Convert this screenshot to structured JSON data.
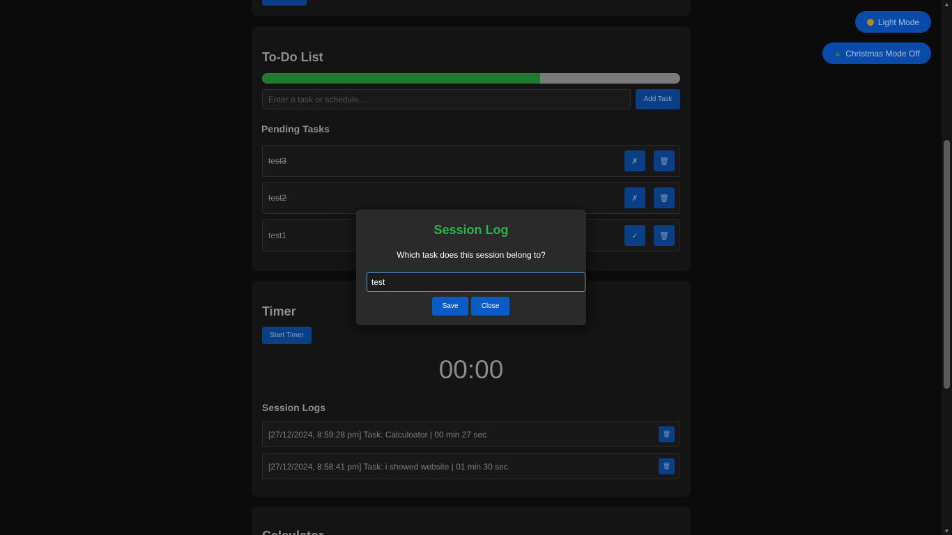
{
  "todo": {
    "title": "To-Do List",
    "progress_fraction": 0.665,
    "input_placeholder": "Enter a task or schedule...",
    "add_label": "Add Task",
    "pending_heading": "Pending Tasks",
    "tasks": [
      {
        "text": "test3",
        "done": true,
        "toggle_glyph": "✗",
        "delete_glyph": "🗑"
      },
      {
        "text": "test2",
        "done": true,
        "toggle_glyph": "✗",
        "delete_glyph": "🗑"
      },
      {
        "text": "test1",
        "done": false,
        "toggle_glyph": "✓",
        "delete_glyph": "🗑"
      }
    ]
  },
  "timer": {
    "title": "Timer",
    "start_label": "Start Timer",
    "display": "00:00",
    "logs_heading": "Session Logs",
    "logs": [
      {
        "text": "[27/12/2024, 8:59:28 pm] Task: Calculoator | 00 min 27 sec",
        "delete_glyph": "🗑"
      },
      {
        "text": "[27/12/2024, 8:58:41 pm] Task: i showed website | 01 min 30 sec",
        "delete_glyph": "🗑"
      }
    ]
  },
  "calculator": {
    "title": "Calculator"
  },
  "toggles": {
    "light_mode": "Light Mode",
    "christmas_mode": "Christmas Mode Off"
  },
  "modal": {
    "title": "Session Log",
    "question": "Which task does this session belong to?",
    "input_value": "test",
    "save_label": "Save",
    "close_label": "Close"
  },
  "colors": {
    "accent_blue": "#0a5bc4",
    "modal_title_green": "#2bb34a",
    "progress_green": "#1f7a30"
  }
}
